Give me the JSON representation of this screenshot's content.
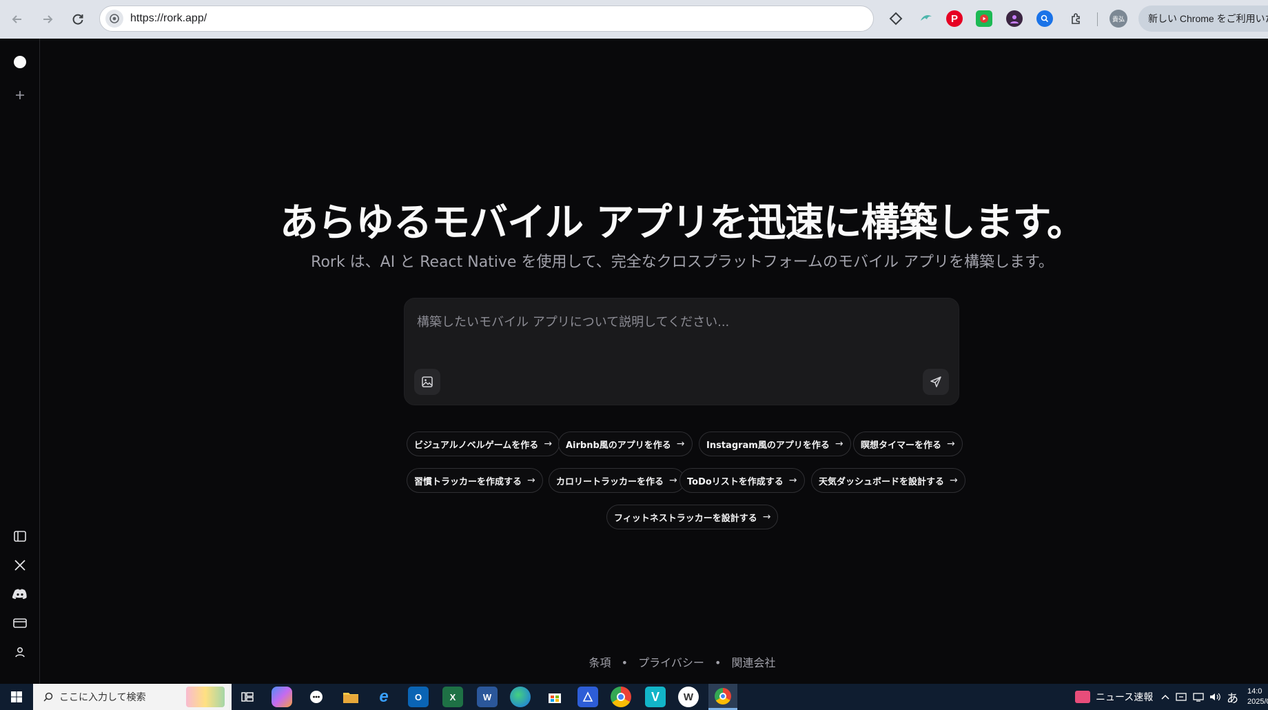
{
  "browser": {
    "url": "https://rork.app/",
    "profile_label": "新しい Chrome をご利用いただけます",
    "extensions": [
      "diamond-extension-icon",
      "dolphin-extension-icon",
      "pinterest-extension-icon",
      "youtube-extension-icon",
      "avatar-extension-icon",
      "search-extension-icon",
      "puzzle-extensions-icon"
    ],
    "profile_avatar_text": "貴弘"
  },
  "rail": {
    "top_items": [
      "logo-dot",
      "new-project"
    ],
    "bottom_items": [
      "toggle-sidebar",
      "x-social",
      "discord",
      "billing",
      "account"
    ]
  },
  "hero": {
    "title": "あらゆるモバイル アプリを迅速に構築します。",
    "subtitle": "Rork は、AI と React Native を使用して、完全なクロスプラットフォームのモバイル アプリを構築します。"
  },
  "prompt": {
    "placeholder": "構築したいモバイル アプリについて説明してください..."
  },
  "suggestions": [
    [
      "ビジュアルノベルゲームを作る",
      "Airbnb風のアプリを作る",
      "Instagram風のアプリを作る",
      "瞑想タイマーを作る"
    ],
    [
      "習慣トラッカーを作成する",
      "カロリートラッカーを作る",
      "ToDoリストを作成する",
      "天気ダッシュボードを設計する"
    ],
    [
      "フィットネストラッカーを設計する"
    ]
  ],
  "footer": {
    "terms": "条項",
    "privacy": "プライバシー",
    "affiliates": "関連会社",
    "separator": "•"
  },
  "taskbar": {
    "search_placeholder": "ここに入力して検索",
    "news_label": "ニュース速報",
    "ime_label": "あ",
    "time": "14:0",
    "date": "2025/0"
  }
}
